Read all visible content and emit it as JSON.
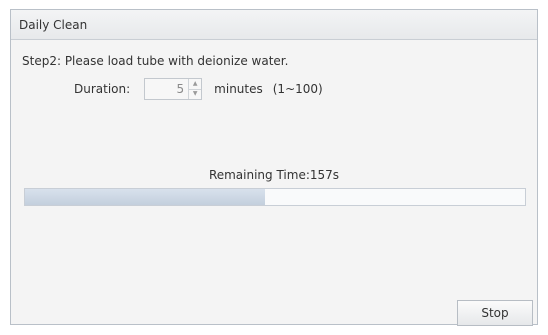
{
  "window": {
    "title": "Daily Clean"
  },
  "step": {
    "text": "Step2:  Please load tube with deionize water."
  },
  "duration": {
    "label": "Duration:",
    "value": "5",
    "up_arrow": "▲",
    "down_arrow": "▼",
    "units": "minutes",
    "range": "(1~100)"
  },
  "progress": {
    "remaining_text": "Remaining Time:157s",
    "fraction": 0.48,
    "colors": {
      "fill": "#c3cfdd",
      "track": "#f9fafb"
    }
  },
  "buttons": {
    "stop_label": "Stop"
  }
}
